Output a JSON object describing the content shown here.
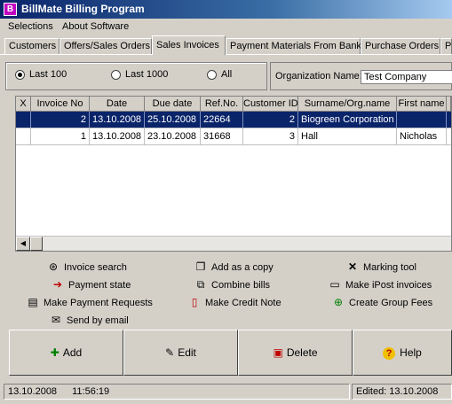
{
  "window": {
    "title": "BillMate Billing Program",
    "icon": "app-icon"
  },
  "menu": {
    "items": [
      "Selections",
      "About Software"
    ]
  },
  "tabs": [
    "Customers",
    "Offers/Sales Orders",
    "Sales Invoices",
    "Payment Materials From Bank",
    "Purchase Orders",
    "P"
  ],
  "active_tab": "Sales Invoices",
  "filter": {
    "options": [
      "Last 100",
      "Last 1000",
      "All"
    ],
    "selected": "Last 100",
    "org_label": "Organization Name:",
    "org_value": "Test Company"
  },
  "table": {
    "columns": [
      "X",
      "Invoice No",
      "Date",
      "Due date",
      "Ref.No.",
      "Customer ID",
      "Surname/Org.name",
      "First name"
    ],
    "rows": [
      {
        "invoice_no": "2",
        "date": "13.10.2008",
        "due": "25.10.2008",
        "ref": "22664",
        "cust": "2",
        "surname": "Biogreen Corporation",
        "first": "",
        "selected": true
      },
      {
        "invoice_no": "1",
        "date": "13.10.2008",
        "due": "23.10.2008",
        "ref": "31668",
        "cust": "3",
        "surname": "Hall",
        "first": "Nicholas",
        "selected": false
      }
    ]
  },
  "actions": {
    "invoice_search": "Invoice search",
    "add_copy": "Add as a copy",
    "marking_tool": "Marking tool",
    "payment_state": "Payment state",
    "combine_bills": "Combine bills",
    "make_ipost": "Make iPost invoices",
    "make_payment_requests": "Make Payment Requests",
    "make_credit_note": "Make Credit Note",
    "create_group_fees": "Create Group Fees",
    "send_email": "Send by email"
  },
  "buttons": {
    "add": "Add",
    "edit": "Edit",
    "delete": "Delete",
    "help": "Help"
  },
  "status": {
    "date": "13.10.2008",
    "time": "11:56:19",
    "edited": "Edited: 13.10.2008"
  },
  "colors": {
    "selection": "#0a246a",
    "titlebar": "#0a246a"
  }
}
